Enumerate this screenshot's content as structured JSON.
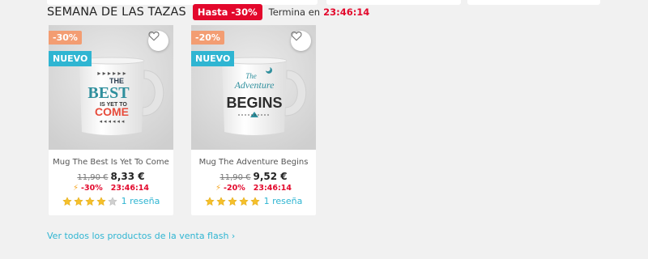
{
  "section": {
    "title": "SEMANA DE LAS TAZAS",
    "badge": "Hasta -30%",
    "ends_label": "Termina en",
    "ends_timer": "23:46:14"
  },
  "products": [
    {
      "name": "Mug The Best Is Yet To Come",
      "discount_flag": "-30%",
      "new_flag": "NUEVO",
      "old_price": "11,90 €",
      "price": "8,33 €",
      "flash_discount": "-30%",
      "flash_timer": "23:46:14",
      "rating": 4,
      "rating_max": 5,
      "reviews": "1 reseña",
      "mug_print": {
        "line1": "THE",
        "line2": "BEST",
        "line3": "IS YET TO",
        "line4": "COME"
      }
    },
    {
      "name": "Mug The Adventure Begins",
      "discount_flag": "-20%",
      "new_flag": "NUEVO",
      "old_price": "11,90 €",
      "price": "9,52 €",
      "flash_discount": "-20%",
      "flash_timer": "23:46:14",
      "rating": 5,
      "rating_max": 5,
      "reviews": "1 reseña",
      "mug_print": {
        "line1": "The",
        "line2": "Adventure",
        "line3": "BEGINS"
      }
    }
  ],
  "footer": {
    "see_all": "Ver todos los productos de la venta flash ›"
  },
  "icons": {
    "wishlist": "heart-outline-icon",
    "flash": "lightning-bolt-icon",
    "star": "star-icon"
  },
  "colors": {
    "accent": "#2fb5d2",
    "sale_red": "#e3082c",
    "discount_orange": "#f39d72",
    "star_filled": "#f5c02b",
    "star_empty": "#cfcfcf"
  }
}
